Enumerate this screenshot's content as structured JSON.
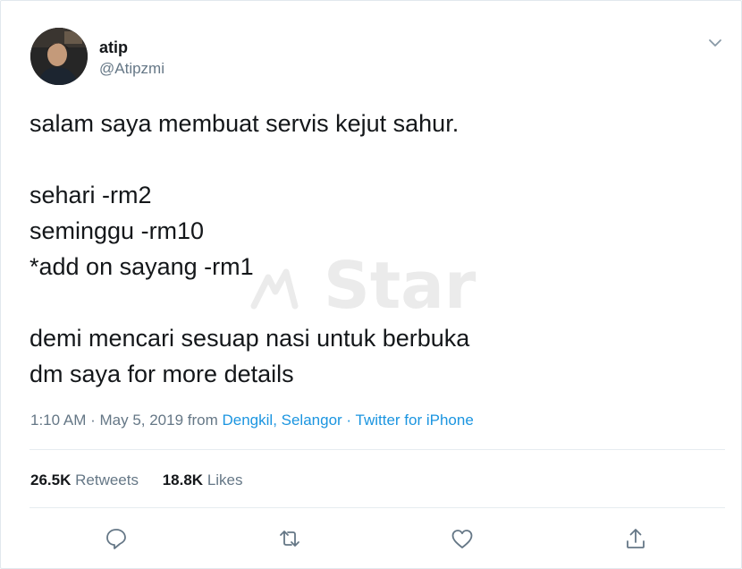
{
  "tweet": {
    "display_name": "atip",
    "handle": "@Atipzmi",
    "lines": {
      "l1": "salam saya membuat servis kejut sahur.",
      "l2": "sehari -rm2",
      "l3": "seminggu -rm10",
      "l4": "*add on sayang -rm1",
      "l5": "demi mencari sesuap nasi untuk berbuka",
      "l6": "dm saya for more details"
    },
    "time": "1:10 AM",
    "sep1": " · ",
    "date": "May 5, 2019",
    "from_label": " from ",
    "location": "Dengkil, Selangor",
    "sep2": " · ",
    "source": "Twitter for iPhone"
  },
  "stats": {
    "retweets_count": "26.5K",
    "retweets_label": "Retweets",
    "likes_count": "18.8K",
    "likes_label": "Likes"
  },
  "watermark": {
    "text": "Star"
  },
  "icons": {
    "caret": "chevron-down-icon",
    "reply": "reply-icon",
    "retweet": "retweet-icon",
    "like": "heart-icon",
    "share": "share-icon"
  },
  "colors": {
    "text": "#14171a",
    "secondary": "#657786",
    "link": "#1b95e0",
    "divider": "#e6ecf0"
  }
}
